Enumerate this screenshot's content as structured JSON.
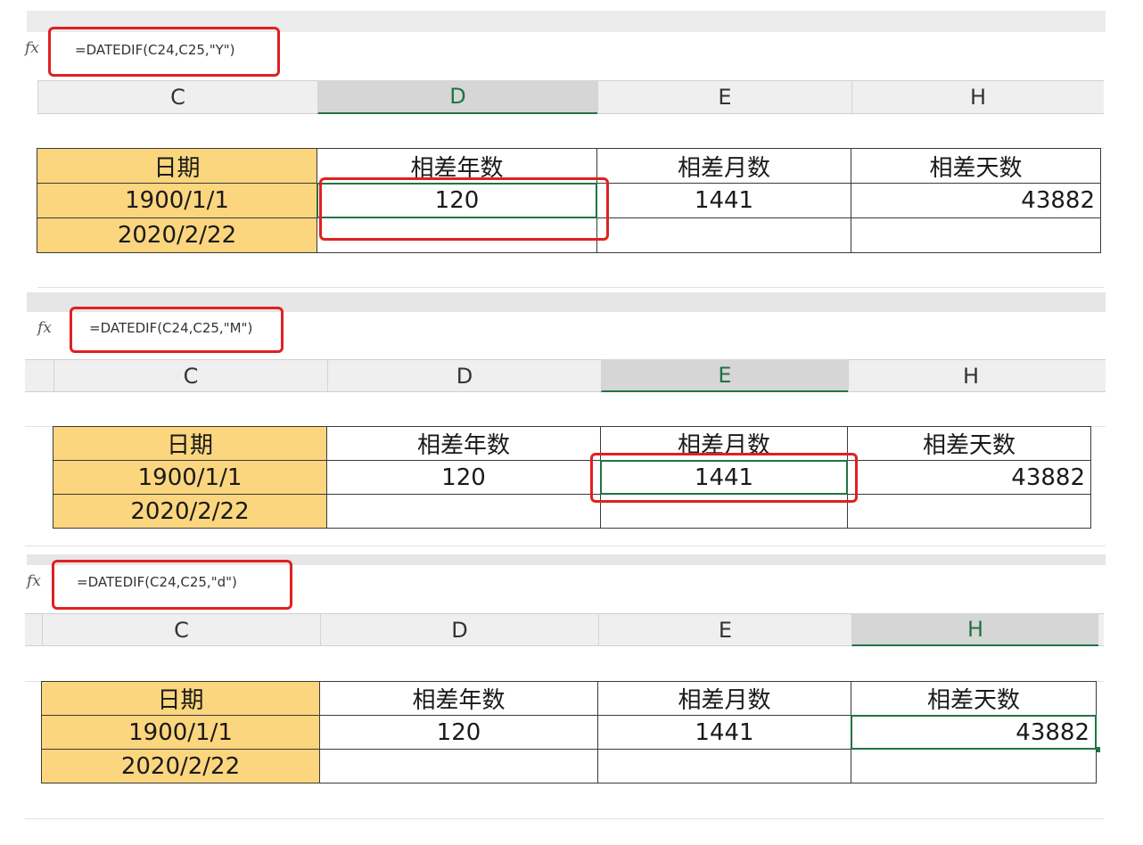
{
  "fx_label": "fx",
  "columns": [
    "C",
    "D",
    "E",
    "H"
  ],
  "table": {
    "header": [
      "日期",
      "相差年数",
      "相差月数",
      "相差天数"
    ],
    "row1": [
      "1900/1/1",
      "120",
      "1441",
      "43882"
    ],
    "row2": [
      "2020/2/22",
      "",
      "",
      ""
    ]
  },
  "panels": [
    {
      "formula": "=DATEDIF(C24,C25,\"Y\")",
      "selected_column": "D"
    },
    {
      "formula": "=DATEDIF(C24,C25,\"M\")",
      "selected_column": "E"
    },
    {
      "formula": "=DATEDIF(C24,C25,\"d\")",
      "selected_column": "H"
    }
  ],
  "colors": {
    "highlight_red": "#e02020",
    "selection_green": "#217346",
    "date_fill": "#fbd67e"
  }
}
